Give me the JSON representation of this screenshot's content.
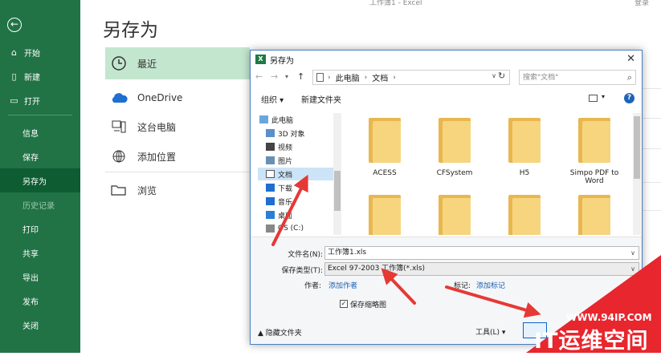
{
  "window_title": "工作簿1 - Excel",
  "window_user": "登录",
  "backstage": {
    "back_icon": "back-arrow-icon",
    "top_items": [
      {
        "label": "开始",
        "icon": "home-icon"
      },
      {
        "label": "新建",
        "icon": "new-document-icon"
      },
      {
        "label": "打开",
        "icon": "open-folder-icon"
      }
    ],
    "lower_items": [
      {
        "label": "信息",
        "state": "normal"
      },
      {
        "label": "保存",
        "state": "normal"
      },
      {
        "label": "另存为",
        "state": "active"
      },
      {
        "label": "历史记录",
        "state": "disabled"
      },
      {
        "label": "打印",
        "state": "normal"
      },
      {
        "label": "共享",
        "state": "normal"
      },
      {
        "label": "导出",
        "state": "normal"
      },
      {
        "label": "发布",
        "state": "normal"
      },
      {
        "label": "关闭",
        "state": "normal"
      }
    ],
    "accent_color": "#217346"
  },
  "save_as": {
    "title": "另存为",
    "locations": [
      {
        "label": "最近",
        "icon": "clock-icon",
        "active": true
      },
      {
        "label": "OneDrive",
        "icon": "cloud-icon",
        "active": false
      },
      {
        "label": "这台电脑",
        "icon": "computer-icon",
        "active": false
      },
      {
        "label": "添加位置",
        "icon": "globe-plus-icon",
        "active": false
      },
      {
        "label": "浏览",
        "icon": "folder-icon",
        "active": false
      }
    ]
  },
  "dialog": {
    "title": "另存为",
    "address": {
      "crumbs": [
        "此电脑",
        "文档"
      ]
    },
    "search_placeholder": "搜索\"文档\"",
    "toolbar": {
      "organize": "组织 ▾",
      "new_folder": "新建文件夹"
    },
    "tree": [
      {
        "label": "此电脑",
        "icon": "computer-icon",
        "selected": false
      },
      {
        "label": "3D 对象",
        "icon": "cube-icon",
        "selected": false
      },
      {
        "label": "视频",
        "icon": "video-icon",
        "selected": false
      },
      {
        "label": "图片",
        "icon": "picture-icon",
        "selected": false
      },
      {
        "label": "文档",
        "icon": "document-icon",
        "selected": true
      },
      {
        "label": "下载",
        "icon": "download-icon",
        "selected": false
      },
      {
        "label": "音乐",
        "icon": "music-icon",
        "selected": false
      },
      {
        "label": "桌面",
        "icon": "desktop-icon",
        "selected": false
      },
      {
        "label": "OS (C:)",
        "icon": "drive-icon",
        "selected": false
      }
    ],
    "folders": [
      {
        "name": "ACESS"
      },
      {
        "name": "CFSystem"
      },
      {
        "name": "H5"
      },
      {
        "name": "Simpo PDF to Word"
      },
      {
        "name": ""
      },
      {
        "name": ""
      },
      {
        "name": ""
      },
      {
        "name": ""
      }
    ],
    "filename_label": "文件名(N):",
    "filename_value": "工作簿1.xls",
    "filetype_label": "保存类型(T):",
    "filetype_value": "Excel 97-2003 工作簿(*.xls)",
    "author_label": "作者:",
    "author_link": "添加作者",
    "tags_label": "标记:",
    "tags_link": "添加标记",
    "thumbnail_label": "保存缩略图",
    "thumbnail_checked": true,
    "hide_folders": "隐藏文件夹",
    "tools": "工具(L)",
    "highlight_color": "#e53935"
  },
  "watermark": {
    "url": "WWW.94IP.COM",
    "brand": "IT运维空间"
  }
}
